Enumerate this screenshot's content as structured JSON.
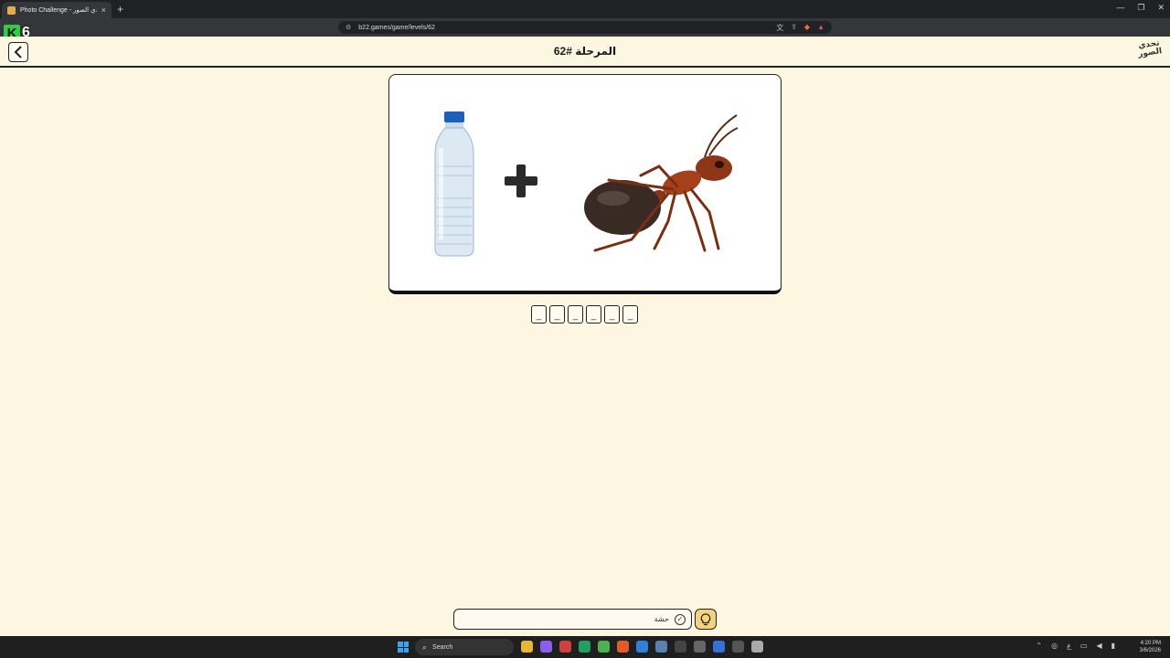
{
  "browser": {
    "tab_title": "Photo Challenge - تحدي الصور",
    "tab_close": "×",
    "new_tab": "+",
    "url": "b22.games/game/levels/62",
    "window_controls": [
      "—",
      "❐",
      "✕"
    ]
  },
  "overlay": {
    "logo_letter": "K",
    "counter": "6"
  },
  "header": {
    "back_icon": "chevron-left-icon",
    "level_title": "المرحلة #62",
    "brand_logo": "تحدي الصور"
  },
  "puzzle": {
    "images": [
      "water-bottle",
      "plus",
      "ant"
    ],
    "slots": [
      "_",
      "_",
      "_",
      "_",
      "_",
      "_"
    ]
  },
  "answer": {
    "label": "حشة",
    "icon": "check-circle-icon",
    "hint_icon": "lightbulb-icon"
  },
  "taskbar": {
    "search_label": "Search",
    "time": "4:20 PM",
    "date": "3/6/2026",
    "apps_colors": [
      "#e8b73a",
      "#8a5cf0",
      "#d04040",
      "#1fa060",
      "#4caf50",
      "#e05a2b",
      "#2f7fdb",
      "#5a7fb0",
      "#444",
      "#666",
      "#3b6fd8",
      "#555",
      "#aaa"
    ]
  },
  "colors": {
    "page_bg": "#fdf6e1",
    "hint_bg": "#f5d37a",
    "overlay_green": "#2fcc44"
  }
}
